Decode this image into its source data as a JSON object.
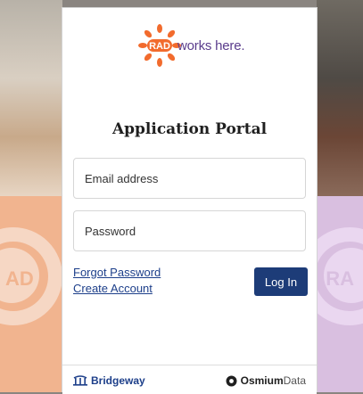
{
  "brand": {
    "logo_badge": "RAD",
    "logo_text": "works here.",
    "color_sun": "#f26b2d",
    "color_text": "#5a3c8c"
  },
  "portal": {
    "title": "Application Portal",
    "email_placeholder": "Email address",
    "password_placeholder": "Password",
    "forgot_password": "Forgot Password",
    "create_account": "Create Account",
    "login_label": "Log In"
  },
  "footer": {
    "left_logo": "Bridgeway",
    "right_logo_bold": "Osmium",
    "right_logo_light": "Data"
  },
  "background": {
    "left_watermark": "AD",
    "right_watermark": "RA"
  }
}
